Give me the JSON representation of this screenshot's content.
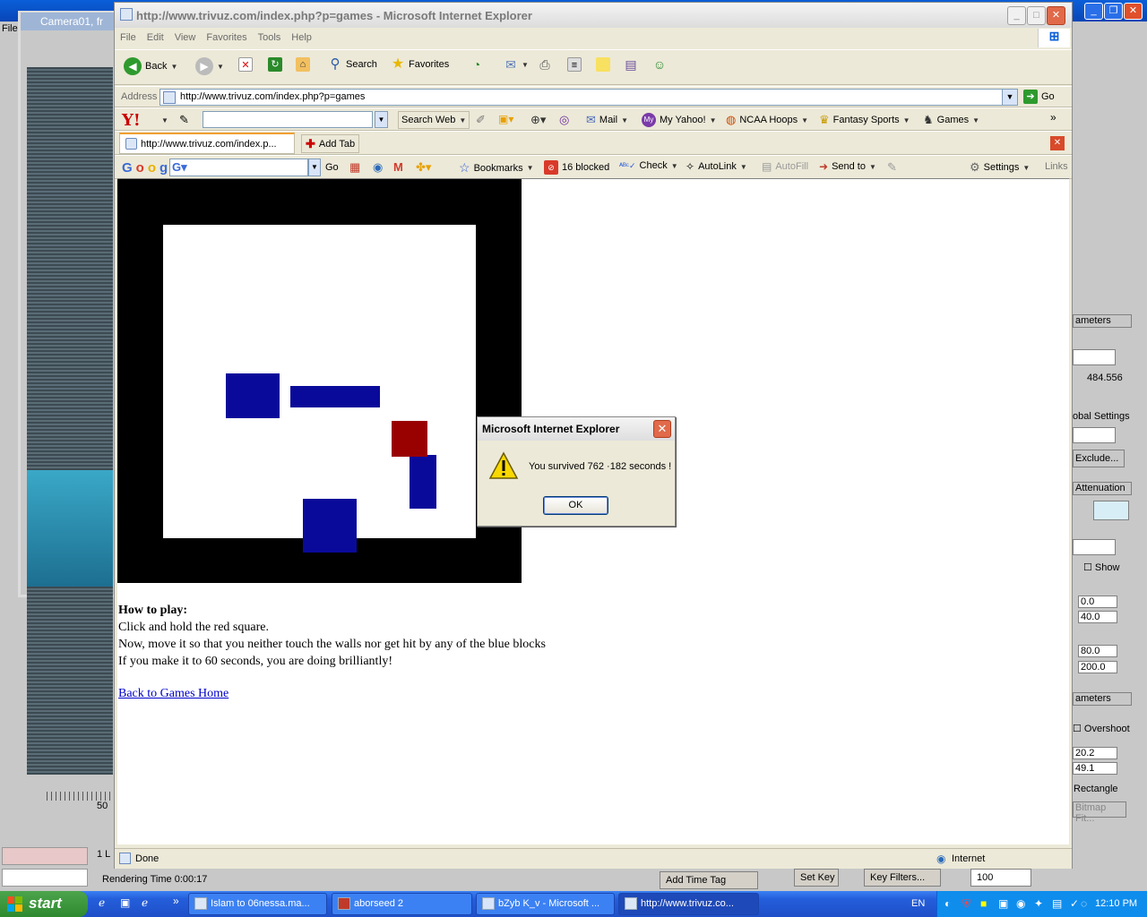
{
  "max_app": {
    "camera_title": "Camera01, fr",
    "file_menu": "File",
    "right_panel": {
      "params1": "ameters",
      "value1": "484.556",
      "global_settings": "obal Settings",
      "exclude": "Exclude...",
      "attenuation": "Attenuation",
      "show": "Show",
      "v_a": "0.0",
      "v_b": "40.0",
      "v_c": "80.0",
      "v_d": "200.0",
      "params2": "ameters",
      "overshoot": "Overshoot",
      "v_e": "20.2",
      "v_f": "49.1",
      "rectangle": "Rectangle",
      "bitmap_fit": "Bitmap Fit..."
    },
    "timeline_50": "50",
    "frame_count": "1 L",
    "rendering_time": "Rendering Time  0:00:17",
    "add_time_tag": "Add Time Tag",
    "set_key": "Set Key",
    "key_filters": "Key Filters...",
    "frame_value": "100"
  },
  "ie": {
    "title": "http://www.trivuz.com/index.php?p=games - Microsoft Internet Explorer",
    "menu": [
      "File",
      "Edit",
      "View",
      "Favorites",
      "Tools",
      "Help"
    ],
    "toolbar": {
      "back": "Back",
      "search": "Search",
      "favorites": "Favorites"
    },
    "address_label": "Address",
    "address_value": "http://www.trivuz.com/index.php?p=games",
    "go_label": "Go",
    "yahoo": {
      "search_web": "Search Web",
      "mail": "Mail",
      "my_yahoo": "My Yahoo!",
      "ncaa": "NCAA Hoops",
      "fantasy": "Fantasy Sports",
      "games": "Games"
    },
    "tab_label": "http://www.trivuz.com/index.p...",
    "add_tab": "Add Tab",
    "google": {
      "go": "Go",
      "bookmarks": "Bookmarks",
      "blocked": "16 blocked",
      "check": "Check",
      "autolink": "AutoLink",
      "autofill": "AutoFill",
      "send_to": "Send to",
      "settings": "Settings",
      "links": "Links"
    },
    "content": {
      "how_to_title": "How to play:",
      "line1": "Click and hold the red square.",
      "line2": "Now, move it so that you neither touch the walls nor get hit by any of the blue blocks",
      "line3": "If you make it to 60 seconds, you are doing brilliantly!",
      "back_link": "Back to Games Home"
    },
    "status_done": "Done",
    "status_zone": "Internet"
  },
  "dialog": {
    "title": "Microsoft Internet Explorer",
    "message": "You survived 762 ·182 seconds !",
    "ok": "OK"
  },
  "taskbar": {
    "start": "start",
    "tasks": [
      "Islam to 06nessa.ma...",
      "aborseed 2",
      "bZyb K_v - Microsoft ...",
      "http://www.trivuz.co..."
    ],
    "lang": "EN",
    "clock": "12:10 PM"
  },
  "colors": {
    "blue_block": "#0a0a9a",
    "red_square": "#990000",
    "link": "#0000cc"
  }
}
